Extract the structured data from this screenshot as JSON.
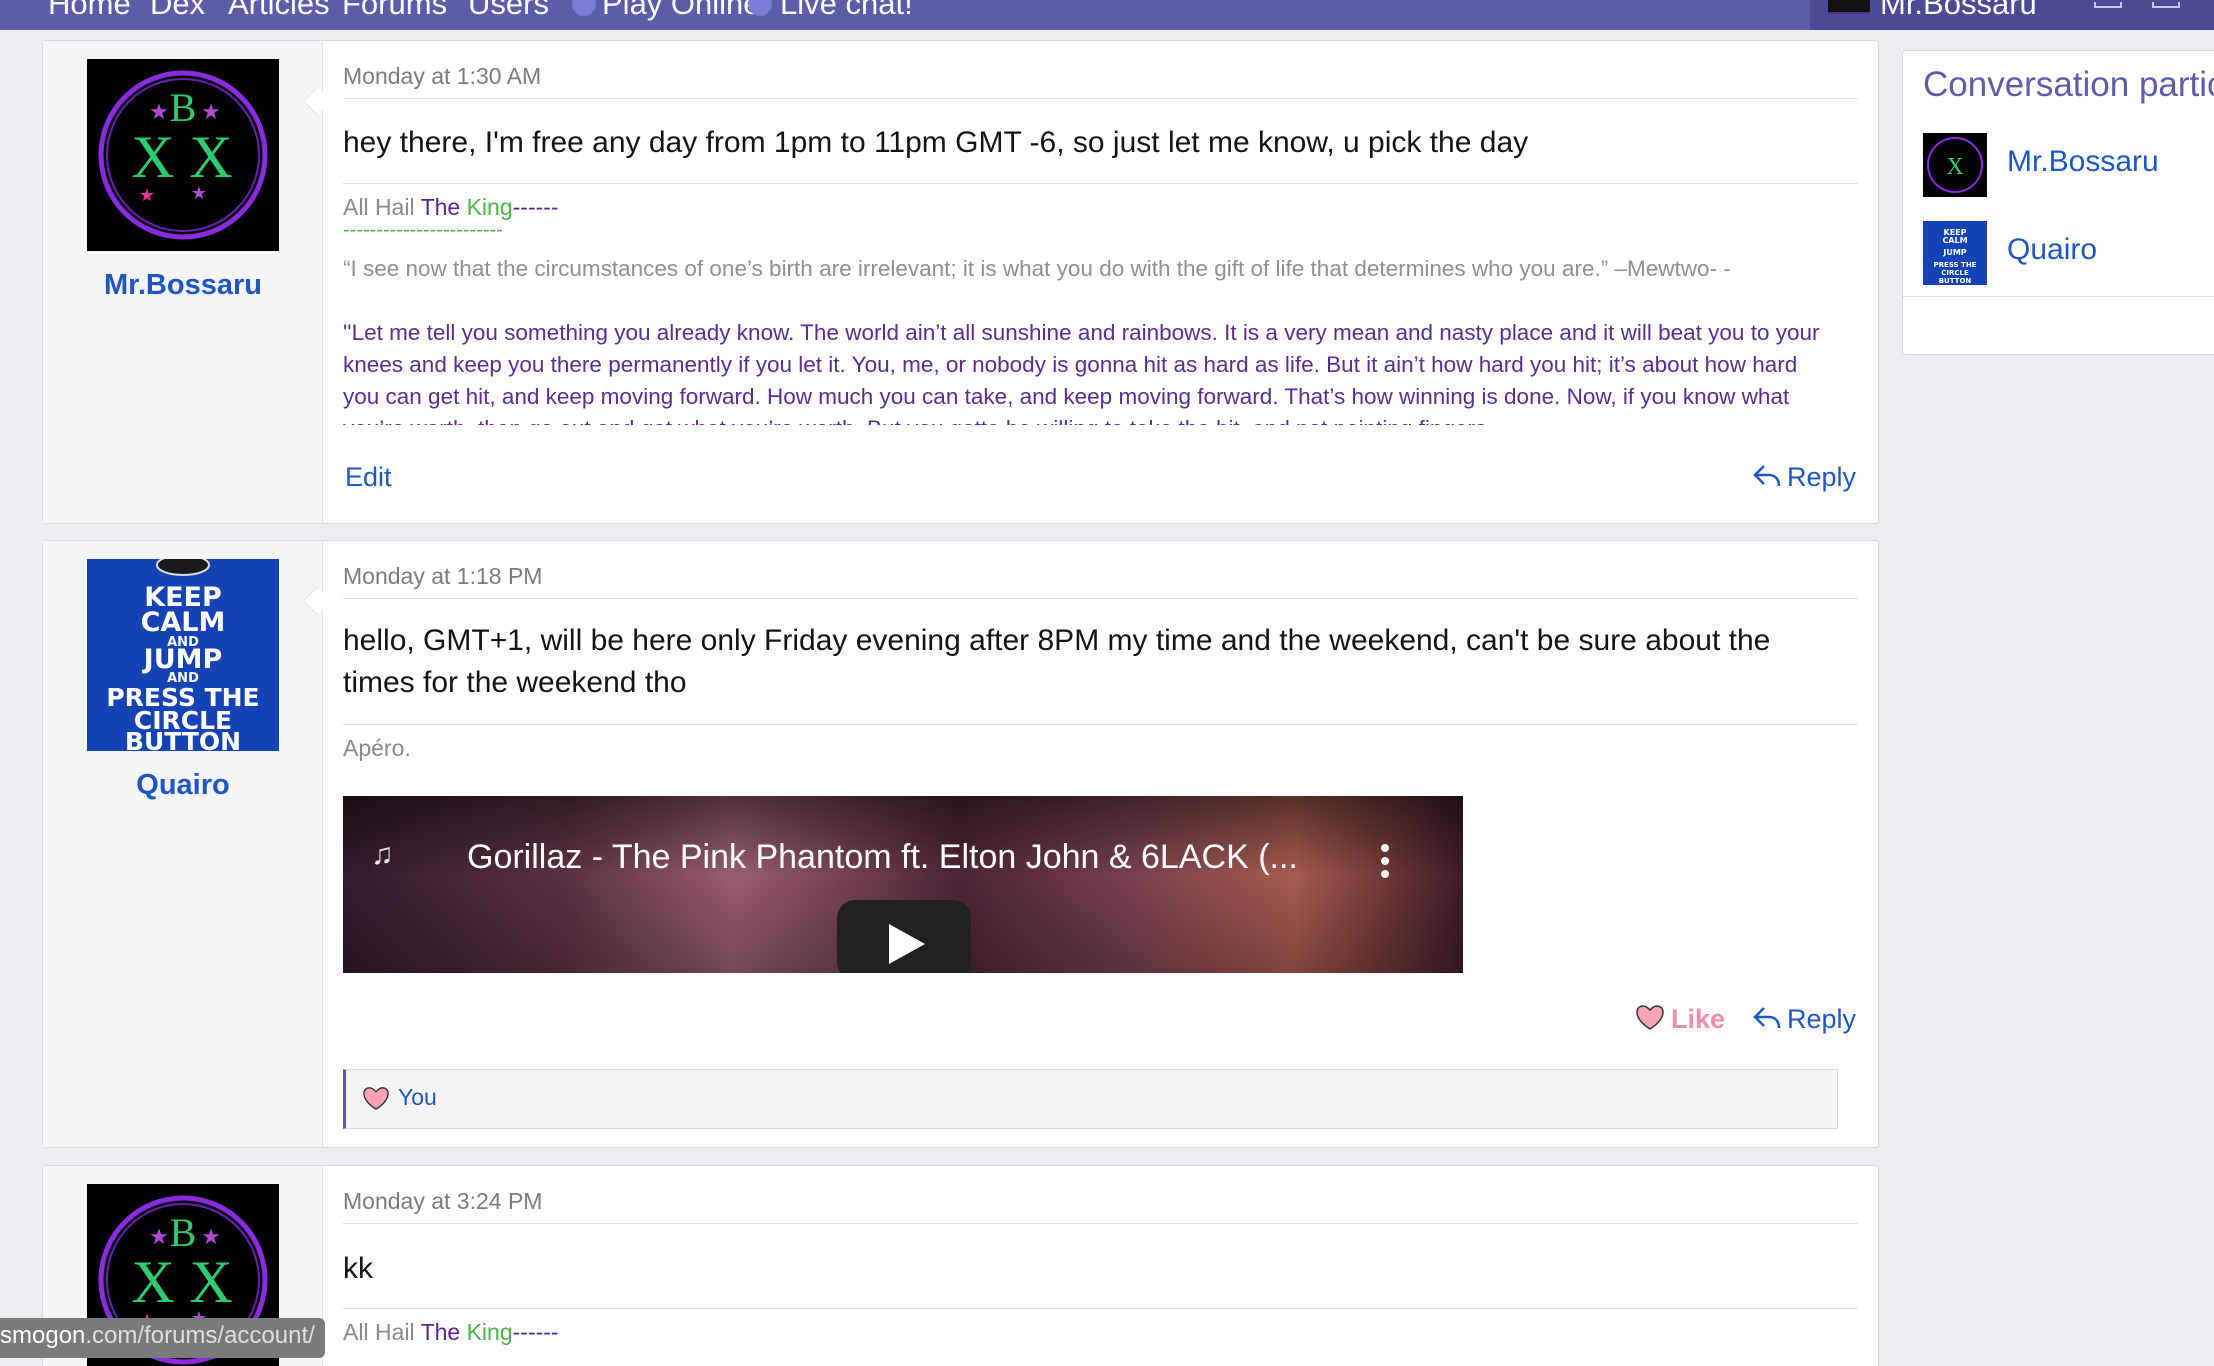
{
  "nav": {
    "items": [
      "Home",
      "Dex",
      "Articles",
      "Forums",
      "Users",
      "Play Online!",
      "Live chat!"
    ],
    "username": "Mr.Bossaru"
  },
  "posts": [
    {
      "author": "Mr.Bossaru",
      "timestamp": "Monday at 1:30 AM",
      "body": "hey there, I'm free any day from 1pm to 11pm GMT -6, so just let me know, u pick the day",
      "signature": {
        "hail": "All Hail",
        "the": "The",
        "king": "King",
        "dashes": "------",
        "green_dashes": "------------------------",
        "quote1": "“I see now that the circumstances of one’s birth are irrelevant; it is what you do with the gift of life that determines who you are.” –Mewtwo- -",
        "quote2": "''Let me tell you something you already know. The world ain’t all sunshine and rainbows. It is a very mean and nasty place and it will beat you to your knees and keep you there permanently if you let it. You, me, or nobody is gonna hit as hard as life. But it ain’t how hard you hit; it’s about how hard you can get hit, and keep moving forward. How much you can take, and keep moving forward. That’s how winning is done. Now, if you know what you’re worth, then go out and get what you’re worth. But you gotta be willing to take the hit, and not pointing fingers"
      },
      "actions": {
        "edit": "Edit",
        "reply": "Reply"
      }
    },
    {
      "author": "Quairo",
      "timestamp": "Monday at 1:18 PM",
      "body": "hello, GMT+1, will be here only Friday evening after 8PM my time and the weekend, can't be sure about the times for the weekend tho",
      "signature": "Apéro.",
      "video": {
        "title": "Gorillaz - The Pink Phantom ft. Elton John & 6LACK (..."
      },
      "actions": {
        "like": "Like",
        "reply": "Reply"
      },
      "reactions": "You"
    },
    {
      "author": "Mr.Bossaru",
      "timestamp": "Monday at 3:24 PM",
      "body": "kk",
      "signature": {
        "hail": "All Hail",
        "the": "The",
        "king": "King",
        "dashes": "------"
      }
    }
  ],
  "avatar_text": {
    "bx": {
      "b": "B",
      "x": "X",
      "x2": "X"
    },
    "kc": [
      "KEEP",
      "CALM",
      "AND",
      "JUMP",
      "AND",
      "PRESS THE",
      "CIRCLE",
      "BUTTON"
    ]
  },
  "sidebar": {
    "title": "Conversation partic",
    "participants": [
      "Mr.Bossaru",
      "Quairo"
    ]
  },
  "status_url": {
    "domain": "smogon",
    "path": ".com/forums/account/"
  },
  "colors": {
    "nav": "#5d5ca8",
    "link": "#1f56c2",
    "like": "#f08ea8",
    "sig_purple": "#5b2d8e",
    "sig_green": "#4bb34b"
  }
}
